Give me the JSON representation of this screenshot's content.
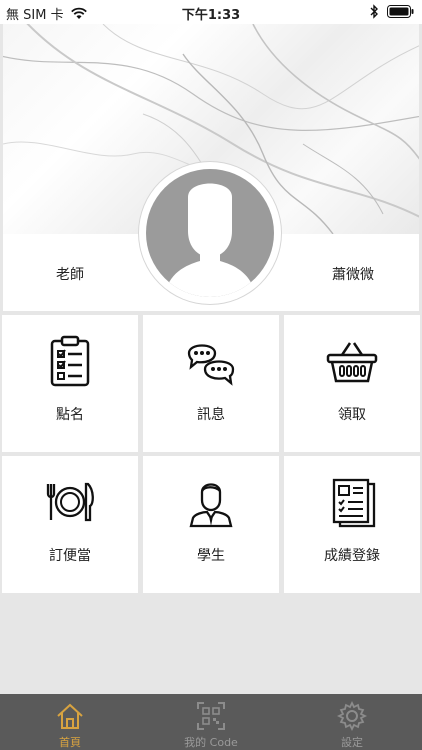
{
  "status_bar": {
    "carrier": "無 SIM 卡",
    "time": "下午1:33"
  },
  "profile": {
    "role": "老師",
    "name": "蕭微微"
  },
  "menu": [
    {
      "label": "點名",
      "icon": "clipboard-checklist-icon"
    },
    {
      "label": "訊息",
      "icon": "chat-bubbles-icon"
    },
    {
      "label": "領取",
      "icon": "basket-icon"
    },
    {
      "label": "訂便當",
      "icon": "plate-fork-knife-icon"
    },
    {
      "label": "學生",
      "icon": "student-icon"
    },
    {
      "label": "成績登錄",
      "icon": "report-document-icon"
    }
  ],
  "tabbar": {
    "home": "首頁",
    "code": "我的 Code",
    "settings": "設定"
  },
  "colors": {
    "active_tab": "#d8a340",
    "tabbar_bg": "#5a5a5a",
    "page_bg": "#e6e6e6"
  }
}
